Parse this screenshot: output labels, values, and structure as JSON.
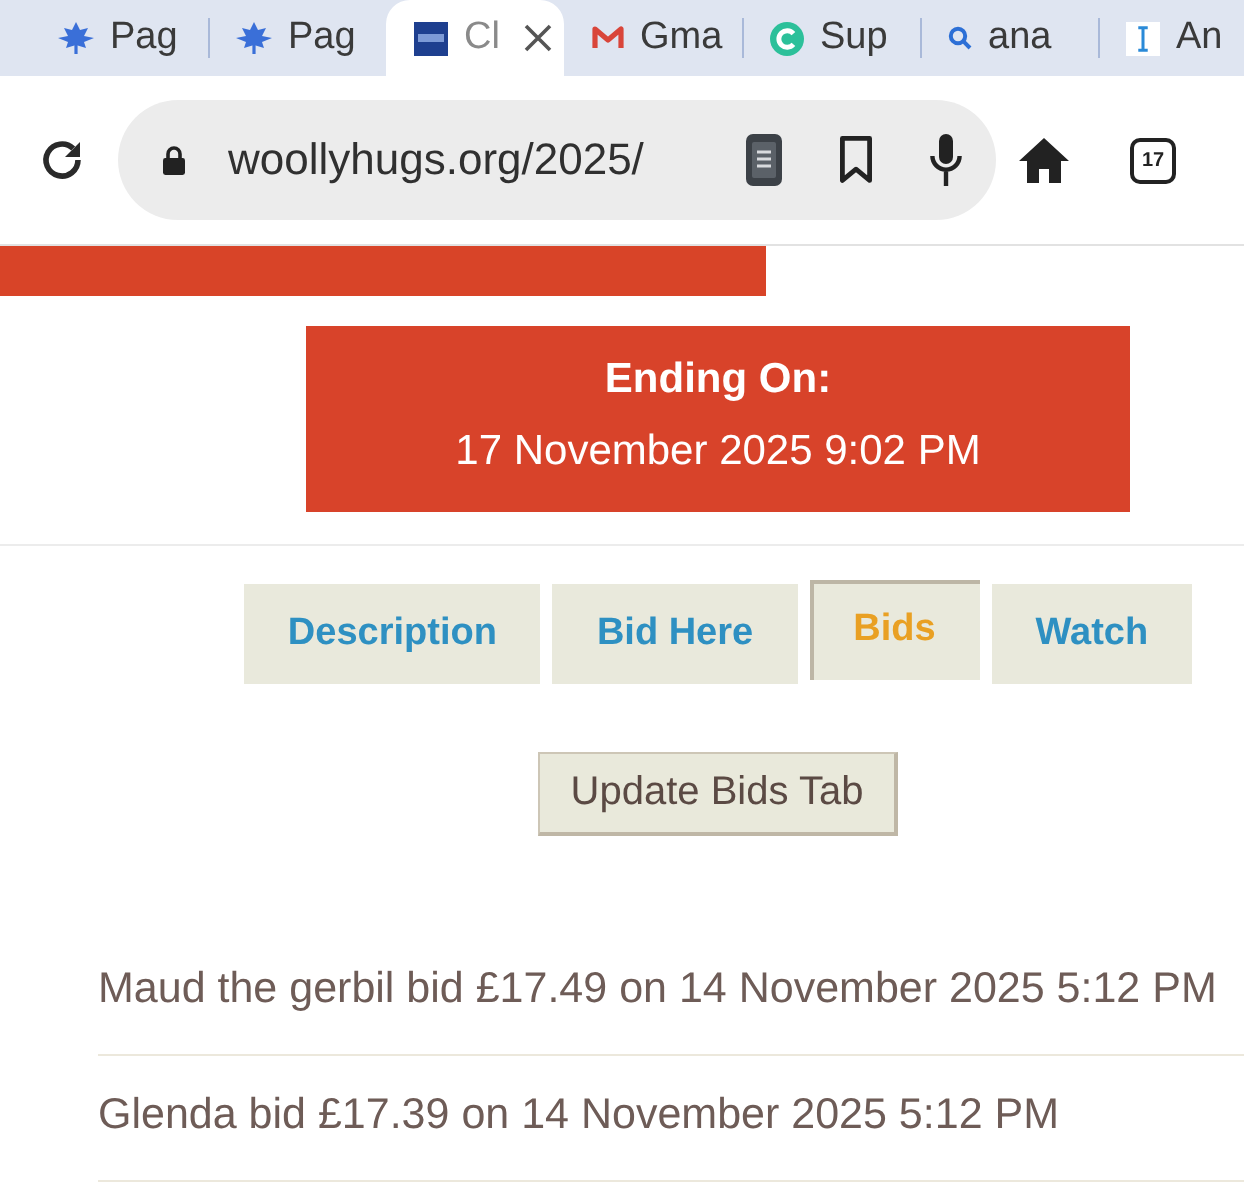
{
  "browser": {
    "tabs": [
      {
        "title": "Pag",
        "kind": "leaf",
        "selected": false
      },
      {
        "title": "Pag",
        "kind": "leaf",
        "selected": false
      },
      {
        "title": "Cl",
        "kind": "tile",
        "selected": true
      },
      {
        "title": "Gma",
        "kind": "mail",
        "selected": false
      },
      {
        "title": "Sup",
        "kind": "circle",
        "selected": false
      },
      {
        "title": "ana",
        "kind": "search",
        "selected": false
      },
      {
        "title": "An",
        "kind": "cursor",
        "selected": false
      }
    ],
    "url": "woollyhugs.org/2025/",
    "tab_count": "17"
  },
  "ending": {
    "label": "Ending On:",
    "date": "17 November 2025 9:02 PM"
  },
  "tabs": [
    {
      "label": "Description",
      "selected": false
    },
    {
      "label": "Bid Here",
      "selected": false
    },
    {
      "label": "Bids",
      "selected": true
    },
    {
      "label": "Watch",
      "selected": false
    }
  ],
  "update_button": "Update Bids Tab",
  "bids": [
    "Maud the gerbil bid £17.49 on 14 November 2025 5:12 PM",
    "Glenda bid £17.39 on 14 November 2025 5:12 PM"
  ]
}
